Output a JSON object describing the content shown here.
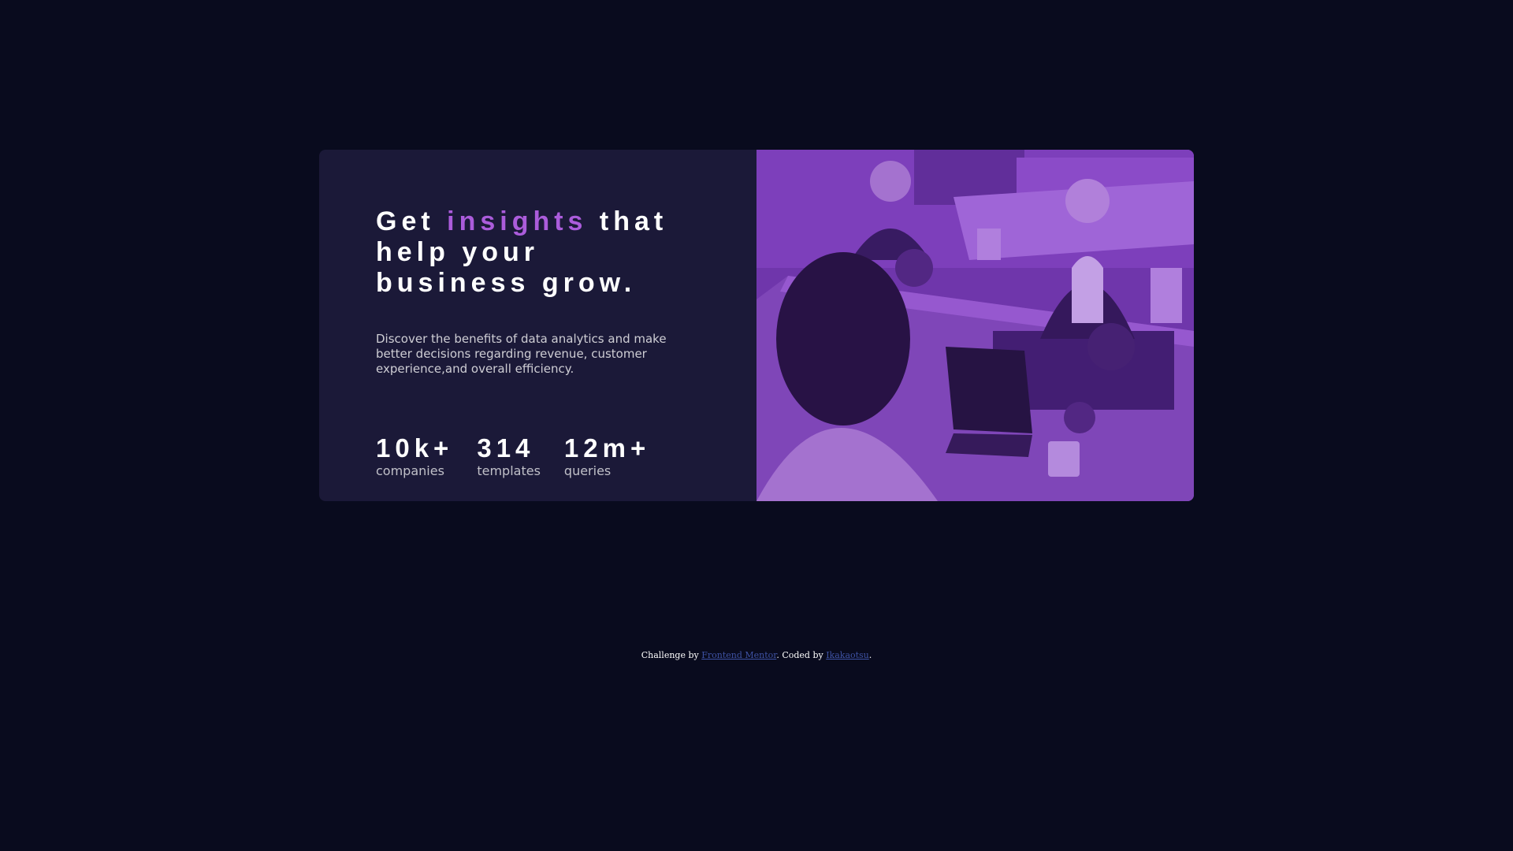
{
  "card": {
    "headline": {
      "before": "Get ",
      "accent": "insights",
      "after": " that help your business grow."
    },
    "description": "Discover the benefits of data analytics and make better decisions regarding revenue, customer experience,and overall efficiency.",
    "stats": [
      {
        "value": "10k+",
        "label": "companies"
      },
      {
        "value": "314",
        "label": "templates"
      },
      {
        "value": "12m+",
        "label": "queries"
      }
    ],
    "image_alt": "three women working at a table with laptops"
  },
  "attribution": {
    "prefix": "Challenge by ",
    "link1": "Frontend Mentor",
    "middle": ". Coded by ",
    "link2": "Ikakaotsu",
    "suffix": "."
  },
  "colors": {
    "background": "#090b1e",
    "card": "#1b1938",
    "accent": "#ab5cdb",
    "link": "#3e52a3"
  }
}
